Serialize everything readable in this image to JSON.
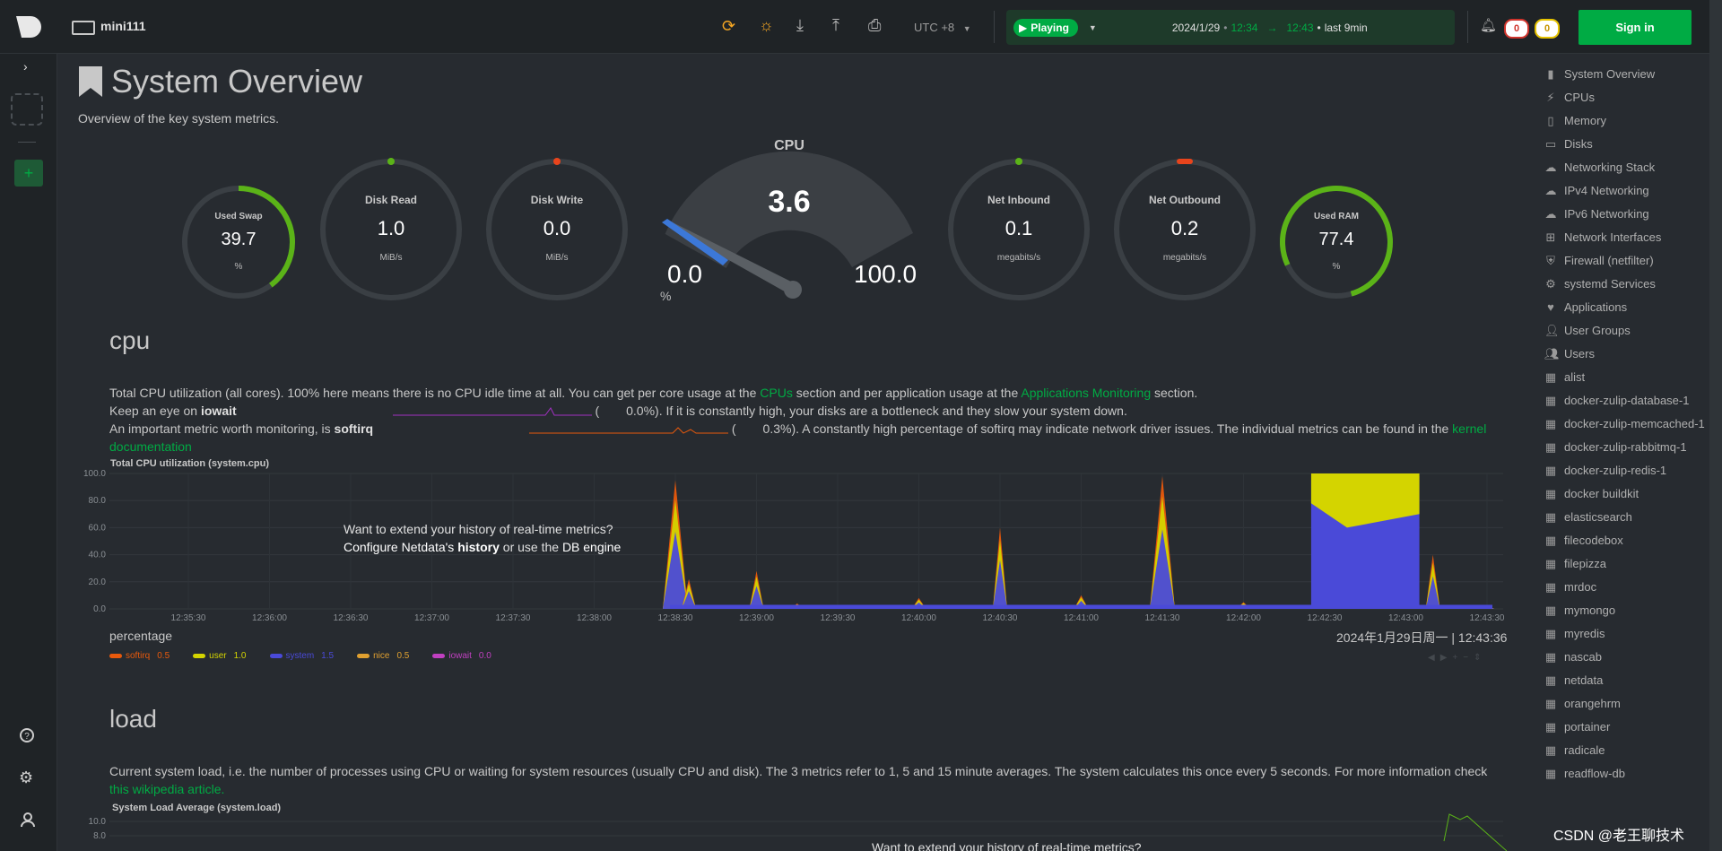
{
  "topbar": {
    "space_name": "mini111",
    "timezone": "UTC +8",
    "play_label": "Playing",
    "date": "2024/1/29",
    "time_from": "12:34",
    "time_to": "12:43",
    "last": "last 9min",
    "badge_red": "0",
    "badge_yellow": "0",
    "signin_label": "Sign in"
  },
  "page": {
    "title": "System Overview",
    "subtitle": "Overview of the key system metrics."
  },
  "gauges": {
    "used_swap": {
      "label": "Used Swap",
      "value": "39.7",
      "unit": "%"
    },
    "disk_read": {
      "label": "Disk Read",
      "value": "1.0",
      "unit": "MiB/s"
    },
    "disk_write": {
      "label": "Disk Write",
      "value": "0.0",
      "unit": "MiB/s"
    },
    "cpu": {
      "label": "CPU",
      "value": "3.6",
      "min": "0.0",
      "max": "100.0",
      "unit": "%"
    },
    "net_inbound": {
      "label": "Net Inbound",
      "value": "0.1",
      "unit": "megabits/s"
    },
    "net_outbound": {
      "label": "Net Outbound",
      "value": "0.2",
      "unit": "megabits/s"
    },
    "used_ram": {
      "label": "Used RAM",
      "value": "77.4",
      "unit": "%"
    }
  },
  "cpu_section": {
    "title": "cpu",
    "p1_a": "Total CPU utilization (all cores). 100% here means there is no CPU idle time at all. You can get per core usage at the ",
    "p1_link1": "CPUs",
    "p1_b": " section and per application usage at the ",
    "p1_link2": "Applications Monitoring",
    "p1_c": " section.",
    "p2_a": "Keep an eye on ",
    "p2_bold": "iowait",
    "p2_val": "0.0%",
    "p2_b": "). If it is constantly high, your disks are a bottleneck and they slow your system down.",
    "p3_a": "An important metric worth monitoring, is ",
    "p3_bold": "softirq",
    "p3_val": "0.3%",
    "p3_b": "). A constantly high percentage of softirq may indicate network driver issues. The individual metrics can be found in the ",
    "p3_link": "kernel documentation",
    "chart_title": "Total CPU utilization (system.cpu)",
    "history_line1": "Want to extend your history of real-time metrics?",
    "history_l2_a": "Configure Netdata's ",
    "history_l2_b": "history",
    "history_l2_c": " or use the ",
    "history_l2_d": "DB engine",
    "units": "percentage",
    "timestamp": "2024年1月29日周一 | 12:43:36"
  },
  "load_section": {
    "title": "load",
    "p1": "Current system load, i.e. the number of processes using CPU or waiting for system resources (usually CPU and disk). The 3 metrics refer to 1, 5 and 15 minute averages. The system calculates this once every 5 seconds. For more information check ",
    "p1_link": "this wikipedia article.",
    "chart_title": "System Load Average (system.load)",
    "history_line1": "Want to extend your history of real-time metrics?"
  },
  "chart_data": [
    {
      "type": "area",
      "title": "Total CPU utilization (system.cpu)",
      "ylabel": "percentage",
      "ylim": [
        0,
        100
      ],
      "yticks": [
        "100.0",
        "80.0",
        "60.0",
        "40.0",
        "20.0",
        "0.0"
      ],
      "xticks": [
        "12:35:30",
        "12:36:00",
        "12:36:30",
        "12:37:00",
        "12:37:30",
        "12:38:00",
        "12:38:30",
        "12:39:00",
        "12:39:30",
        "12:40:00",
        "12:40:30",
        "12:41:00",
        "12:41:30",
        "12:42:00",
        "12:42:30",
        "12:43:00",
        "12:43:30"
      ],
      "series": [
        {
          "name": "softirq",
          "value": "0.5",
          "color": "#e8590c"
        },
        {
          "name": "user",
          "value": "1.0",
          "color": "#d4d400"
        },
        {
          "name": "system",
          "value": "1.5",
          "color": "#4a4ad8"
        },
        {
          "name": "nice",
          "value": "0.5",
          "color": "#e0a030"
        },
        {
          "name": "iowait",
          "value": "0.0",
          "color": "#c040c0"
        }
      ],
      "x": [
        "12:38:30",
        "12:38:35",
        "12:39:00",
        "12:39:15",
        "12:40:00",
        "12:40:30",
        "12:41:00",
        "12:41:30",
        "12:42:00",
        "12:42:30",
        "12:42:40",
        "12:42:50",
        "12:43:00",
        "12:43:10",
        "12:43:30"
      ],
      "total": [
        95,
        22,
        28,
        4,
        8,
        60,
        10,
        98,
        5,
        100,
        100,
        100,
        65,
        40,
        3
      ]
    },
    {
      "type": "line",
      "title": "System Load Average (system.load)",
      "yticks": [
        "10.0",
        "8.0"
      ]
    }
  ],
  "sidebar": {
    "items": [
      {
        "label": "System Overview",
        "icon": "bookmark-icon"
      },
      {
        "label": "CPUs",
        "icon": "bolt-icon"
      },
      {
        "label": "Memory",
        "icon": "memory-icon"
      },
      {
        "label": "Disks",
        "icon": "disk-icon"
      },
      {
        "label": "Networking Stack",
        "icon": "cloud-icon"
      },
      {
        "label": "IPv4 Networking",
        "icon": "cloud-icon"
      },
      {
        "label": "IPv6 Networking",
        "icon": "cloud-icon"
      },
      {
        "label": "Network Interfaces",
        "icon": "sitemap-icon"
      },
      {
        "label": "Firewall (netfilter)",
        "icon": "shield-icon"
      },
      {
        "label": "systemd Services",
        "icon": "cogs-icon"
      },
      {
        "label": "Applications",
        "icon": "heart-icon"
      },
      {
        "label": "User Groups",
        "icon": "user-icon"
      },
      {
        "label": "Users",
        "icon": "users-icon"
      },
      {
        "label": "alist",
        "icon": "grid-icon"
      },
      {
        "label": "docker-zulip-database-1",
        "icon": "grid-icon"
      },
      {
        "label": "docker-zulip-memcached-1",
        "icon": "grid-icon"
      },
      {
        "label": "docker-zulip-rabbitmq-1",
        "icon": "grid-icon"
      },
      {
        "label": "docker-zulip-redis-1",
        "icon": "grid-icon"
      },
      {
        "label": "docker buildkit",
        "icon": "grid-icon"
      },
      {
        "label": "elasticsearch",
        "icon": "grid-icon"
      },
      {
        "label": "filecodebox",
        "icon": "grid-icon"
      },
      {
        "label": "filepizza",
        "icon": "grid-icon"
      },
      {
        "label": "mrdoc",
        "icon": "grid-icon"
      },
      {
        "label": "mymongo",
        "icon": "grid-icon"
      },
      {
        "label": "myredis",
        "icon": "grid-icon"
      },
      {
        "label": "nascab",
        "icon": "grid-icon"
      },
      {
        "label": "netdata",
        "icon": "grid-icon"
      },
      {
        "label": "orangehrm",
        "icon": "grid-icon"
      },
      {
        "label": "portainer",
        "icon": "grid-icon"
      },
      {
        "label": "radicale",
        "icon": "grid-icon"
      },
      {
        "label": "readflow-db",
        "icon": "grid-icon"
      }
    ]
  },
  "watermark": "CSDN @老王聊技术"
}
